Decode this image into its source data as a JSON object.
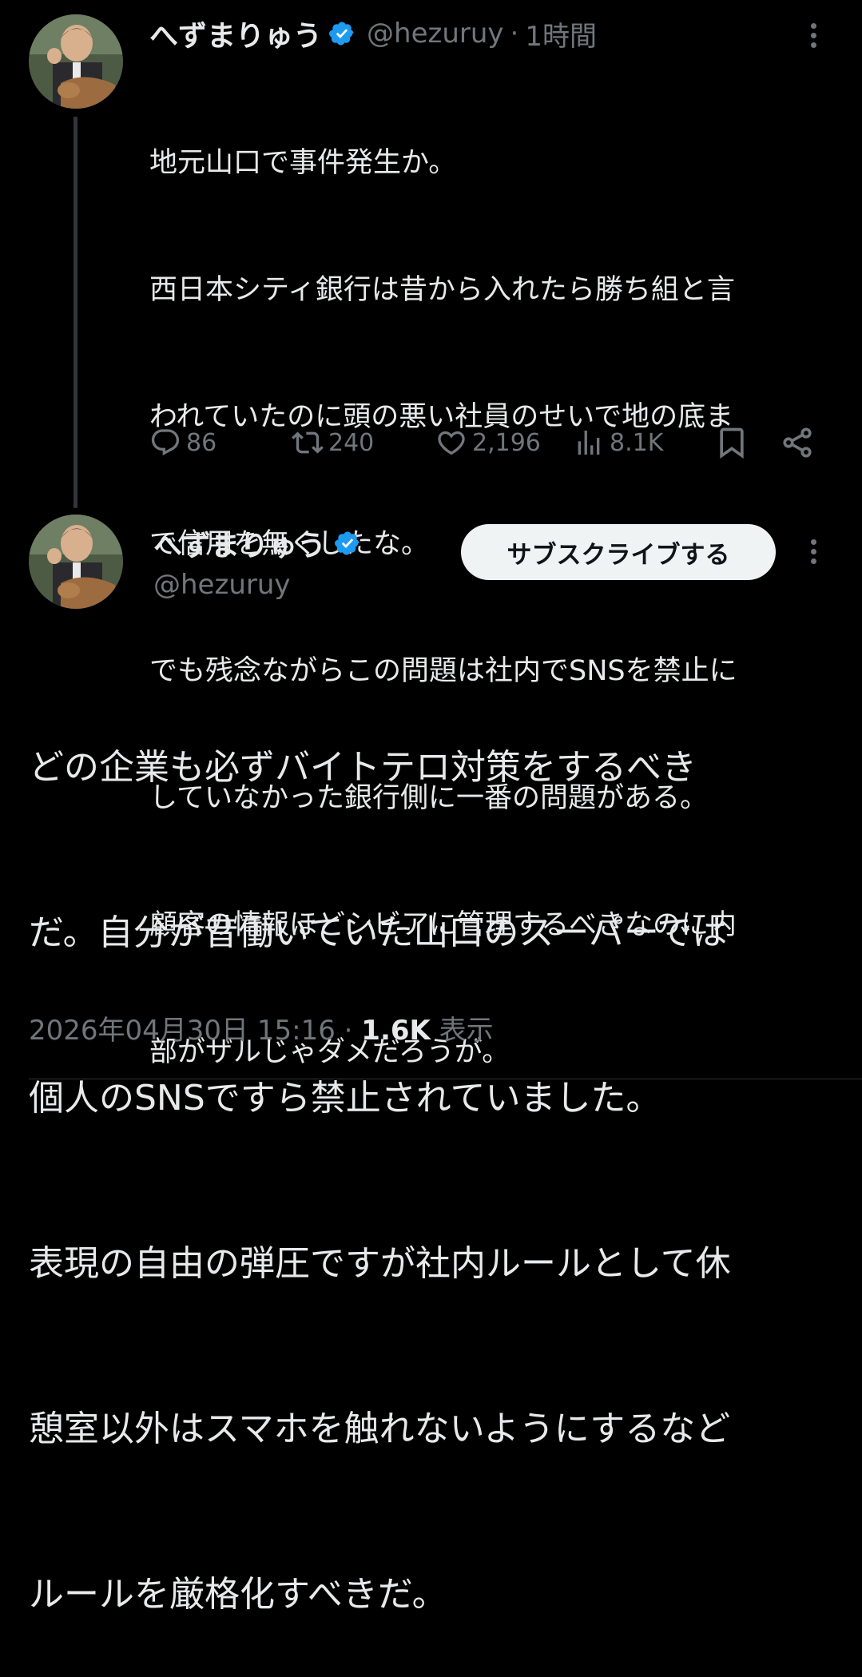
{
  "reply_target": {
    "author_name": "へずまりゅう",
    "author_handle": "@hezuruy",
    "separator": "·",
    "time_ago": "1時間",
    "text_lines": [
      "地元山口で事件発生か。",
      "西日本シティ銀行は昔から入れたら勝ち組と言",
      "われていたのに頭の悪い社員のせいで地の底ま",
      "で信用を無くしたな。",
      "でも残念ながらこの問題は社内でSNSを禁止に",
      "していなかった銀行側に一番の問題がある。",
      "顧客の情報ほどシビアに管理するべきなのに内",
      "部がザルじゃダメだろうが。"
    ],
    "actions": {
      "replies": "86",
      "reposts": "240",
      "likes": "2,196",
      "views": "8.1K"
    }
  },
  "main_tweet": {
    "author_name": "へずまりゅう",
    "author_handle": "@hezuruy",
    "subscribe_label": "サブスクライブする",
    "text_lines": [
      "どの企業も必ずバイトテロ対策をするべき",
      "だ。自分が昔働いていた山口のスーパーでは",
      "個人のSNSですら禁止されていました。",
      "表現の自由の弾圧ですが社内ルールとして休",
      "憩室以外はスマホを触れないようにするなど",
      "ルールを厳格化すべきだ。"
    ],
    "timestamp": "2026年04月30日 15:16",
    "meta_separator": "·",
    "view_count": "1.6K",
    "view_label": "表示"
  },
  "colors": {
    "background": "#000000",
    "text": "#e7e9ea",
    "secondary": "#71767b",
    "verified": "#1d9bf0"
  },
  "icons": [
    "verified-badge-icon",
    "more-icon",
    "reply-icon",
    "repost-icon",
    "like-icon",
    "views-icon",
    "bookmark-icon",
    "share-icon"
  ]
}
